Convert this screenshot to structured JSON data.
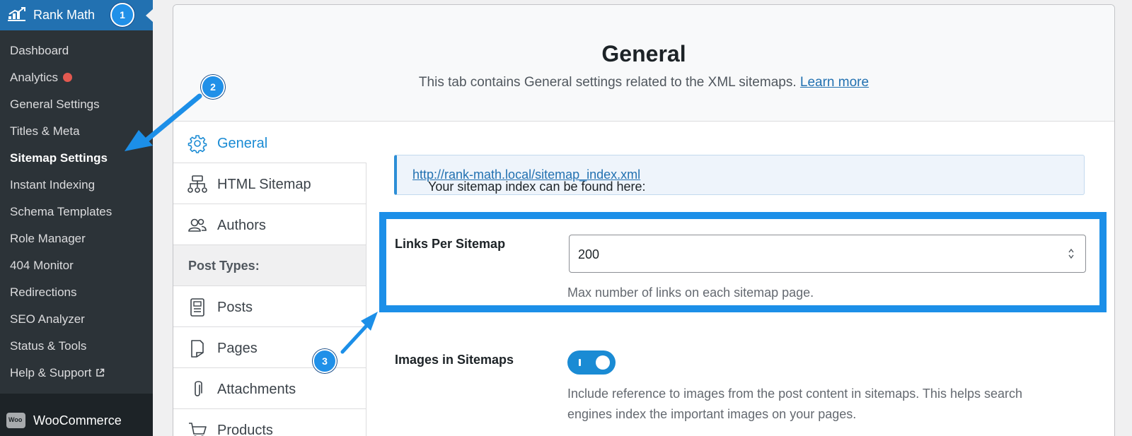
{
  "sidebar": {
    "title": "Rank Math",
    "items": [
      {
        "label": "Dashboard"
      },
      {
        "label": "Analytics"
      },
      {
        "label": "General Settings"
      },
      {
        "label": "Titles & Meta"
      },
      {
        "label": "Sitemap Settings"
      },
      {
        "label": "Instant Indexing"
      },
      {
        "label": "Schema Templates"
      },
      {
        "label": "Role Manager"
      },
      {
        "label": "404 Monitor"
      },
      {
        "label": "Redirections"
      },
      {
        "label": "SEO Analyzer"
      },
      {
        "label": "Status & Tools"
      },
      {
        "label": "Help & Support"
      }
    ],
    "woocommerce": {
      "icon_text": "Woo",
      "label": "WooCommerce"
    }
  },
  "badges": [
    "1",
    "2",
    "3"
  ],
  "header": {
    "title": "General",
    "description": "This tab contains General settings related to the XML sitemaps.",
    "learn_more": "Learn more"
  },
  "tabs": [
    {
      "label": "General",
      "icon": "gear-icon",
      "active": true
    },
    {
      "label": "HTML Sitemap",
      "icon": "sitemap-icon"
    },
    {
      "label": "Authors",
      "icon": "users-icon"
    },
    {
      "label": "Post Types:",
      "group": true
    },
    {
      "label": "Posts",
      "icon": "document-icon"
    },
    {
      "label": "Pages",
      "icon": "page-icon"
    },
    {
      "label": "Attachments",
      "icon": "paperclip-icon"
    },
    {
      "label": "Products",
      "icon": "cart-icon"
    }
  ],
  "notice": {
    "text": "Your sitemap index can be found here: ",
    "link": "http://rank-math.local/sitemap_index.xml"
  },
  "links_per_sitemap": {
    "label": "Links Per Sitemap",
    "value": "200",
    "help": "Max number of links on each sitemap page."
  },
  "images_in_sitemaps": {
    "label": "Images in Sitemaps",
    "enabled": true,
    "help_line1": "Include reference to images from the post content in sitemaps. This helps search",
    "help_line2": "engines index the important images on your pages."
  },
  "colors": {
    "accent": "#1a8bd4",
    "highlight": "#1c8fe8",
    "sidebar": "#1d2327",
    "sidebar_header": "#2271b1"
  }
}
